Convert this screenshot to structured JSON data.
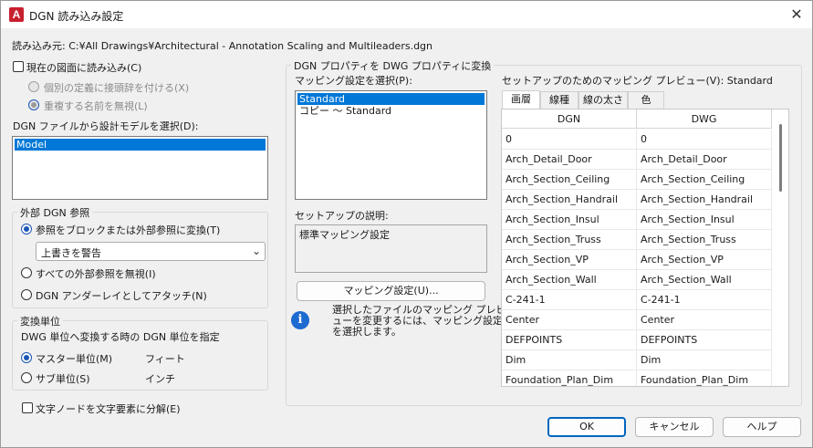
{
  "window": {
    "title": "DGN 読み込み設定",
    "app_icon": "A",
    "close": "✕"
  },
  "source_path": "読み込み元: C:¥All Drawings¥Architectural - Annotation Scaling and Multileaders.dgn",
  "import_current": {
    "label": "現在の図面に読み込み(C)",
    "checked": false
  },
  "sub_options": [
    {
      "label": "個別の定義に接頭辞を付ける(X)",
      "selected": false
    },
    {
      "label": "重複する名前を無視(L)",
      "selected": true
    }
  ],
  "model_select": {
    "label": "DGN ファイルから設計モデルを選択(D):",
    "items": [
      "Model"
    ],
    "selected": 0
  },
  "external_ref": {
    "title": "外部 DGN 参照",
    "options": [
      {
        "label": "参照をブロックまたは外部参照に変換(T)",
        "selected": true
      },
      {
        "label": "すべての外部参照を無視(I)",
        "selected": false
      },
      {
        "label": "DGN アンダーレイとしてアタッチ(N)",
        "selected": false
      }
    ],
    "combo_value": "上書きを警告"
  },
  "units": {
    "title": "変換単位",
    "description": "DWG 単位へ変換する時の DGN 単位を指定",
    "options": [
      {
        "label": "マスター単位(M)",
        "value": "フィート",
        "selected": true
      },
      {
        "label": "サブ単位(S)",
        "value": "インチ",
        "selected": false
      }
    ]
  },
  "explode_text": {
    "label": "文字ノードを文字要素に分解(E)",
    "checked": false
  },
  "mapping": {
    "group_title": "DGN プロパティを DWG プロパティに変換",
    "select_label": "マッピング設定を選択(P):",
    "items": [
      "Standard",
      "コピー 〜 Standard"
    ],
    "selected": 0,
    "desc_label": "セットアップの説明:",
    "desc_value": "標準マッピング設定",
    "button": "マッピング設定(U)...",
    "info_text": [
      "選択したファイルのマッピング プレビ",
      "ューを変更するには、マッピング設定",
      "を選択します。"
    ]
  },
  "preview": {
    "label": "セットアップのためのマッピング プレビュー(V): Standard",
    "tabs": [
      "画層",
      "線種",
      "線の太さ",
      "色"
    ],
    "active_tab": 0,
    "columns": [
      "DGN",
      "DWG"
    ],
    "rows": [
      [
        "0",
        "0"
      ],
      [
        "Arch_Detail_Door",
        "Arch_Detail_Door"
      ],
      [
        "Arch_Section_Ceiling",
        "Arch_Section_Ceiling"
      ],
      [
        "Arch_Section_Handrail",
        "Arch_Section_Handrail"
      ],
      [
        "Arch_Section_Insul",
        "Arch_Section_Insul"
      ],
      [
        "Arch_Section_Truss",
        "Arch_Section_Truss"
      ],
      [
        "Arch_Section_VP",
        "Arch_Section_VP"
      ],
      [
        "Arch_Section_Wall",
        "Arch_Section_Wall"
      ],
      [
        "C-241-1",
        "C-241-1"
      ],
      [
        "Center",
        "Center"
      ],
      [
        "DEFPOINTS",
        "DEFPOINTS"
      ],
      [
        "Dim",
        "Dim"
      ],
      [
        "Foundation_Plan_Dim",
        "Foundation_Plan_Dim"
      ]
    ]
  },
  "buttons": {
    "ok": "OK",
    "cancel": "キャンセル",
    "help": "ヘルプ"
  }
}
